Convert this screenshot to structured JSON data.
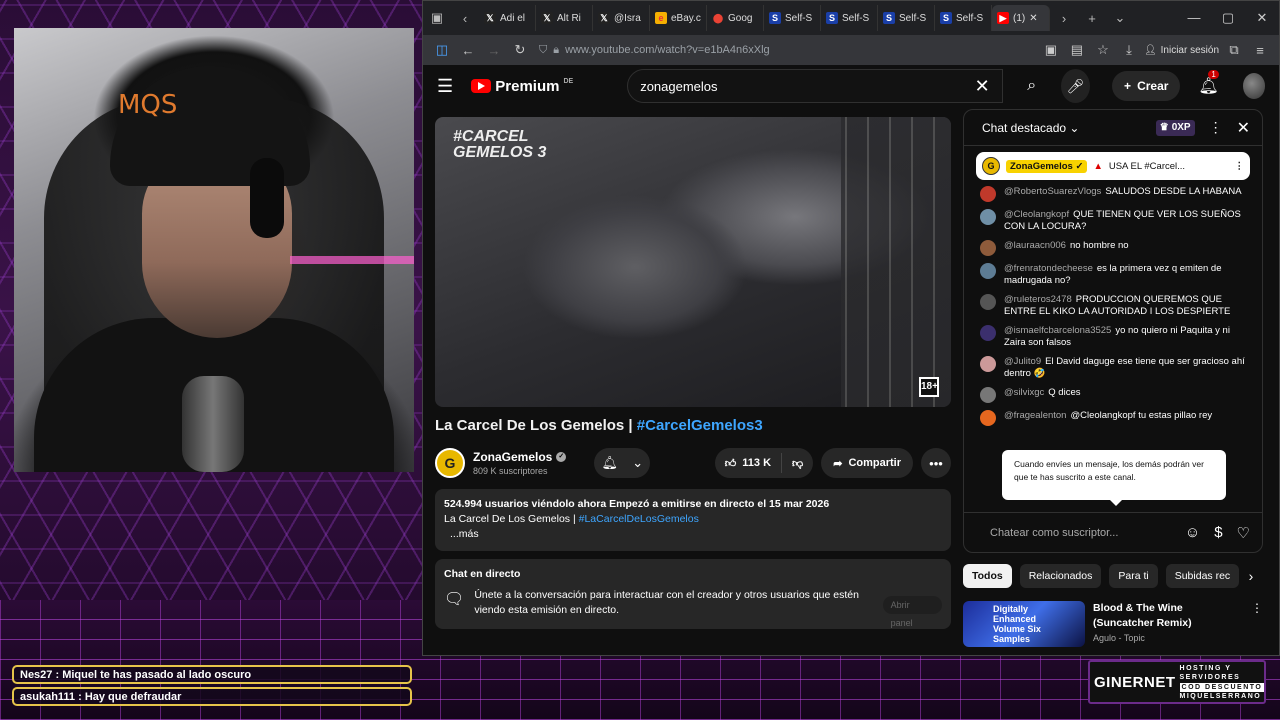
{
  "overlay": {
    "chat": [
      {
        "text": "Nes27 : Miquel te has pasado al lado oscuro"
      },
      {
        "text": "asukah111 : Hay que defraudar"
      }
    ],
    "sponsor": {
      "logo": "GINERNET",
      "line1": "HOSTING Y",
      "line2": "SERVIDORES",
      "line3": "COD DESCUENTO",
      "line4": "MIQUELSERRANO"
    },
    "cap_logo": "MQS"
  },
  "browser": {
    "tabs": [
      {
        "label": "Adi el"
      },
      {
        "label": "Alt Ri"
      },
      {
        "label": "@Isra"
      },
      {
        "label": "eBay.c"
      },
      {
        "label": "Goog"
      },
      {
        "label": "Self-S"
      },
      {
        "label": "Self-S"
      },
      {
        "label": "Self-S"
      },
      {
        "label": "Self-S"
      },
      {
        "label": "(1)"
      }
    ],
    "url": "www.youtube.com/watch?v=e1bA4n6xXlg",
    "signin": "Iniciar sesión"
  },
  "yt": {
    "logo": "Premium",
    "region": "DE",
    "search_value": "zonagemelos",
    "create_label": "Crear",
    "notif_count": "1",
    "video": {
      "watermark_line1": "#CARCEL",
      "watermark_line2": "GEMELOS 3",
      "age_badge": "18+",
      "title": "La Carcel De Los Gemelos | ",
      "title_tag": "#CarcelGemelos3",
      "channel": "ZonaGemelos",
      "subscribers": "809 K suscriptores",
      "likes": "113 K",
      "share": "Compartir",
      "desc_stats": "524.994 usuarios viéndolo ahora  Empezó a emitirse en directo el 15 mar 2026",
      "desc_line": "La Carcel De Los Gemelos | ",
      "desc_link": "#LaCarcelDeLosGemelos",
      "desc_more": "...más",
      "livechat_title": "Chat en directo",
      "livechat_text": "Únete a la conversación para interactuar con el creador y otros usuarios que estén viendo esta emisión en directo.",
      "livechat_btn": "Abrir panel"
    },
    "chat": {
      "title": "Chat destacado",
      "points": "0XP",
      "pinned_name": "ZonaGemelos",
      "pinned_text": "USA EL #Carcel...",
      "messages": [
        {
          "author": "@RobertoSuarezVlogs",
          "text": "SALUDOS DESDE LA HABANA",
          "color": "#c0392b"
        },
        {
          "author": "@Cleolangkopf",
          "text": "QUE TIENEN QUE VER LOS SUEÑOS CON LA LOCURA?",
          "color": "#6f8fa6"
        },
        {
          "author": "@lauraacn006",
          "text": "no hombre no",
          "color": "#8e5b3b"
        },
        {
          "author": "@frenratondecheese",
          "text": "es la primera vez q emiten de madrugada no?",
          "color": "#5d7c94"
        },
        {
          "author": "@ruleteros2478",
          "text": "PRODUCCION QUEREMOS QUE ENTRE EL KIKO LA AUTORIDAD I LOS DESPIERTE",
          "color": "#555"
        },
        {
          "author": "@ismaelfcbarcelona3525",
          "text": "yo no quiero ni Paquita y ni Zaira son falsos",
          "color": "#3b2f6d"
        },
        {
          "author": "@Julito9",
          "text": "El David daguge ese tiene que ser gracioso ahí dentro 🤣",
          "color": "#c99"
        },
        {
          "author": "@silvixgc",
          "text": "Q dices",
          "color": "#777"
        },
        {
          "author": "@fragealenton",
          "text": "@Cleolangkopf tu estas pillao rey",
          "color": "#e6671f"
        }
      ],
      "tooltip": "Cuando envíes un mensaje, los demás podrán ver que te has suscrito a este canal.",
      "input_placeholder": "Chatear como suscriptor..."
    },
    "chips": [
      "Todos",
      "Relacionados",
      "Para ti",
      "Subidas rec"
    ],
    "rec": {
      "thumb_text": "Digitally Enhanced Volume Six Samples",
      "title": "Blood & The Wine (Suncatcher Remix)",
      "channel": "Agulo - Topic"
    }
  }
}
